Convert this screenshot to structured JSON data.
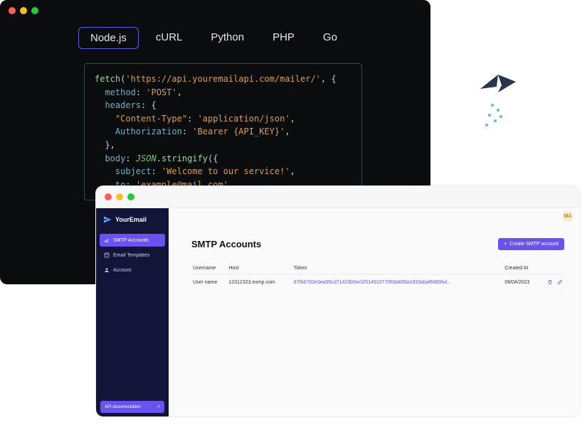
{
  "code_window": {
    "tabs": [
      "Node.js",
      "cURL",
      "Python",
      "PHP",
      "Go"
    ],
    "active_tab": 0,
    "code": {
      "l1_fn": "fetch",
      "l1_str": "'https://api.youremailapi.com/mailer/'",
      "l2_key": "method",
      "l2_val": "'POST'",
      "l3_key": "headers",
      "l4_key": "\"Content-Type\"",
      "l4_val": "'application/json'",
      "l5_key": "Authorization",
      "l5_val": "'Bearer {API_KEY}'",
      "l7_key": "body",
      "l7_obj": "JSON",
      "l7_fn": "stringify",
      "l8_key": "subject",
      "l8_val": "'Welcome to our service!'",
      "l9_key": "to",
      "l9_val": "'example@mail.com'"
    }
  },
  "dashboard": {
    "brand": "YourEmail",
    "sidebar": {
      "items": [
        {
          "label": "SMTP Accounts",
          "icon": "bars"
        },
        {
          "label": "Email Templates",
          "icon": "template"
        },
        {
          "label": "Account",
          "icon": "user"
        }
      ],
      "active": 0,
      "doc_button": "API documentation"
    },
    "avatar": "MA",
    "page_title": "SMTP Accounts",
    "create_button": "Create SMTP account",
    "table": {
      "headers": [
        "Username",
        "Host",
        "Token",
        "Created At",
        ""
      ],
      "rows": [
        {
          "username": "User name",
          "host": "12312323.exmp.com",
          "token": "87fb6792e3ea55cd71419b5ecf251491077069a830a1833abaf6889bd...",
          "created": "08/04/2023"
        }
      ]
    }
  }
}
